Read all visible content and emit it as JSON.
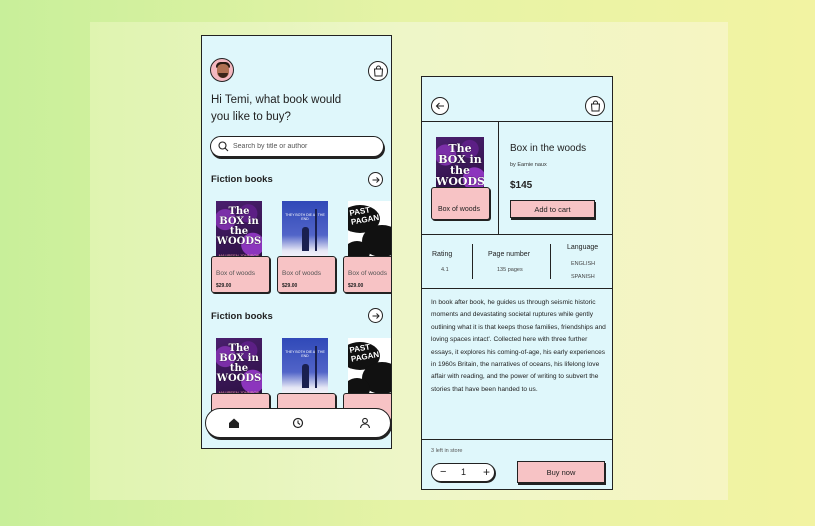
{
  "colors": {
    "accent_pink": "#f7c3c5",
    "screen_bg": "#dff7fb",
    "outline": "#222222"
  },
  "home": {
    "greeting": "Hi Temi, what book would you like to buy?",
    "search": {
      "placeholder": "Search by title or author"
    },
    "sections": [
      {
        "title": "Fiction books",
        "books": [
          {
            "cover_title": "The BOX in the WOODS",
            "cover_author": "MAUREEN JOHNSON",
            "title": "Box of woods",
            "price": "$29.00"
          },
          {
            "cover_title": "THEY BOTH DIE AT THE END",
            "title": "Box of woods",
            "price": "$29.00"
          },
          {
            "cover_title": "PAST PAGAN",
            "title": "Box of woods",
            "price": "$29.00"
          }
        ]
      },
      {
        "title": "Fiction books",
        "books": [
          {
            "cover_title": "The BOX in the WOODS",
            "cover_author": "MAUREEN JOHNSON"
          },
          {
            "cover_title": "THEY BOTH DIE AT THE END"
          },
          {
            "cover_title": "PAST PAGAN"
          }
        ]
      }
    ],
    "nav": [
      "home-icon",
      "history-icon",
      "profile-icon"
    ]
  },
  "detail": {
    "cover_title": "The BOX in the WOODS",
    "cover_author": "MAUREEN JOHNSON",
    "tag_label": "Box of woods",
    "title": "Box in the woods",
    "author": "by Earnie naux",
    "price": "$145",
    "add_to_cart": "Add to cart",
    "stats": {
      "rating_label": "Rating",
      "rating_value": "4.1",
      "pages_label": "Page number",
      "pages_value": "135 pages",
      "language_label": "Language",
      "language_1": "ENGLISH",
      "language_2": "SPANISH"
    },
    "description": "In book after book, he guides us through seismic historic moments and devastating societal ruptures while gently outlining what it is that keeps those families, friendships and loving spaces intact'. Collected here with three further essays, it explores his coming-of-age, his early experiences in 1960s Britain, the narratives of oceans, his lifelong love affair with reading, and the power of writing to subvert the stories that have been handed to us.",
    "stock": "3 left in store",
    "quantity": "1",
    "buy_now": "Buy now"
  }
}
